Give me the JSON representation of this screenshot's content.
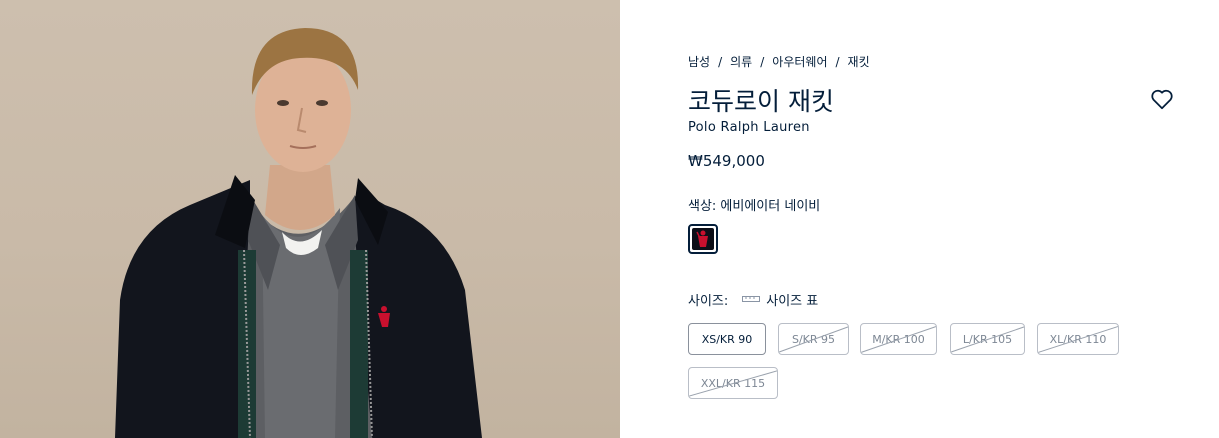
{
  "breadcrumb": [
    "남성",
    "의류",
    "아우터웨어",
    "재킷"
  ],
  "breadcrumb_separator": "/",
  "product": {
    "title": "코듀로이 재킷",
    "brand": "Polo Ralph Lauren",
    "price": "₩549,000"
  },
  "color": {
    "label": "색상: 에비에이터 네이비",
    "swatch_color": "#0d0f18",
    "logo_color": "#c8102e"
  },
  "size": {
    "label": "사이즈:",
    "guide_label": "사이즈 표",
    "options": [
      {
        "label": "XS/KR 90",
        "available": true
      },
      {
        "label": "S/KR 95",
        "available": false
      },
      {
        "label": "M/KR 100",
        "available": false
      },
      {
        "label": "L/KR 105",
        "available": false
      },
      {
        "label": "XL/KR 110",
        "available": false
      },
      {
        "label": "XXL/KR 115",
        "available": false
      }
    ]
  },
  "icons": {
    "wishlist": "heart-icon",
    "size_guide": "ruler-icon",
    "logo": "polo-pony-logo"
  },
  "colors": {
    "text": "#041e3a",
    "border": "#b9bec7",
    "photo_background": "#cdbfae"
  }
}
